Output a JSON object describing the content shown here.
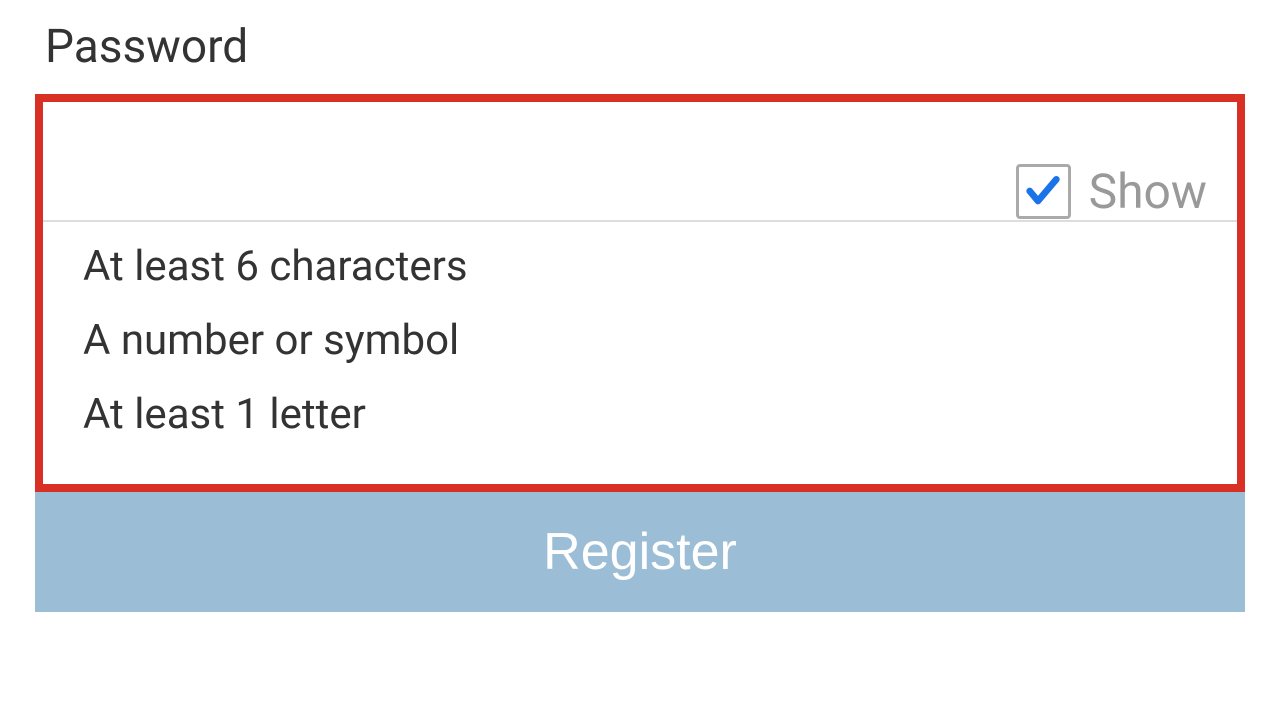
{
  "password": {
    "label": "Password",
    "show_label": "Show",
    "show_checked": true,
    "requirements": [
      "At least 6 characters",
      "A number or symbol",
      "At least 1 letter"
    ]
  },
  "register": {
    "label": "Register"
  },
  "colors": {
    "highlight_border": "#d93025",
    "button_bg": "#9bbdd6",
    "check": "#1a73e8"
  }
}
